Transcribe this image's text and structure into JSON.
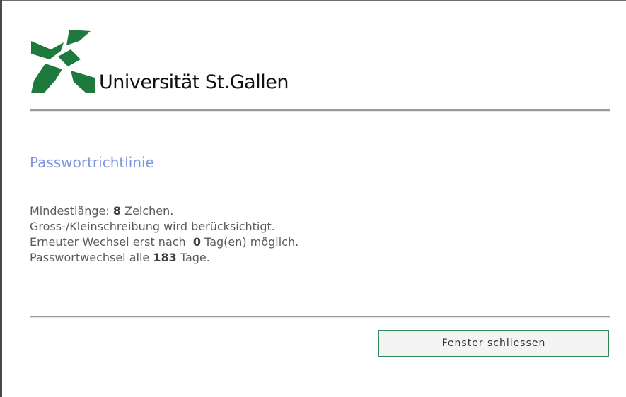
{
  "logo": {
    "name": "Universität St.Gallen",
    "icon": "hsg-logo-icon",
    "color": "#1e7a3c"
  },
  "heading": "Passwortrichtlinie",
  "policy": {
    "line1": {
      "prefix": "Mindestlänge: ",
      "value": "8",
      "suffix": " Zeichen."
    },
    "line2": "Gross-/Kleinschreibung wird berücksichtigt.",
    "line3": {
      "prefix": "Erneuter Wechsel erst nach  ",
      "value": "0",
      "suffix": " Tag(en) möglich."
    },
    "line4": {
      "prefix": "Passwortwechsel alle ",
      "value": "183",
      "suffix": " Tage."
    }
  },
  "close_button": {
    "label": "Fenster schliessen"
  },
  "colors": {
    "heading": "#7f95e0",
    "text": "#5b5b5b",
    "button_border": "#2e8b57"
  }
}
